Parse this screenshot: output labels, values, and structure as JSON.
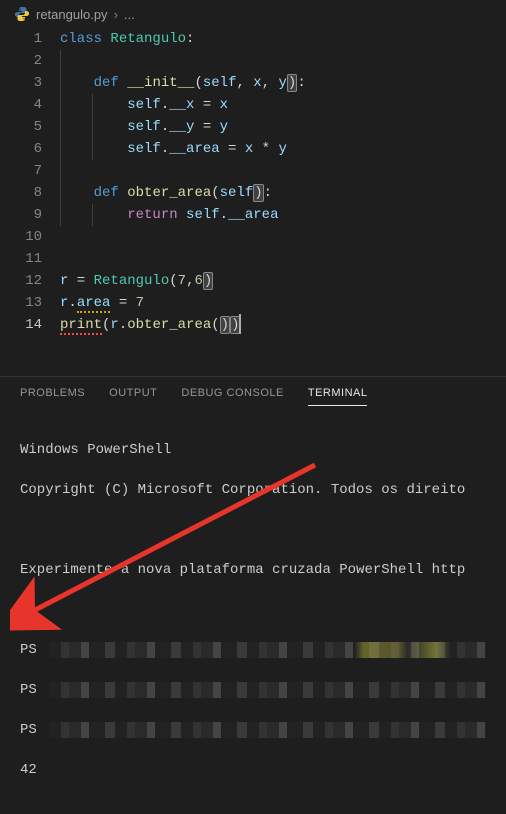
{
  "breadcrumb": {
    "filename": "retangulo.py",
    "overflow": "..."
  },
  "editor": {
    "lines": {
      "l1": {
        "kw": "class",
        "name": "Retangulo",
        "colon": ":"
      },
      "l3": {
        "kw": "def",
        "name": "__init__",
        "params_open": "(",
        "self": "self",
        "c1": ", ",
        "p1": "x",
        "c2": ", ",
        "p2": "y",
        "params_close": ")",
        "colon": ":"
      },
      "l4": {
        "self": "self",
        "dot": ".",
        "attr": "__x",
        "eq": " = ",
        "rhs": "x"
      },
      "l5": {
        "self": "self",
        "dot": ".",
        "attr": "__y",
        "eq": " = ",
        "rhs": "y"
      },
      "l6": {
        "self": "self",
        "dot": ".",
        "attr": "__area",
        "eq": " = ",
        "a": "x",
        "op": " * ",
        "b": "y"
      },
      "l8": {
        "kw": "def",
        "name": "obter_area",
        "params_open": "(",
        "self": "self",
        "params_close": ")",
        "colon": ":"
      },
      "l9": {
        "kw": "return",
        "sp": " ",
        "self": "self",
        "dot": ".",
        "attr": "__area"
      },
      "l12": {
        "var": "r",
        "eq": " = ",
        "cls": "Retangulo",
        "open": "(",
        "a": "7",
        "c": ",",
        "b": "6",
        "close": ")"
      },
      "l13": {
        "var": "r",
        "dot": ".",
        "attr": "area",
        "eq": " = ",
        "val": "7"
      },
      "l14": {
        "fn": "print",
        "open": "(",
        "var": "r",
        "dot": ".",
        "method": "obter_area",
        "open2": "(",
        "close2": ")",
        "close": ")"
      }
    },
    "line_numbers": [
      "1",
      "2",
      "3",
      "4",
      "5",
      "6",
      "7",
      "8",
      "9",
      "10",
      "11",
      "12",
      "13",
      "14"
    ]
  },
  "panel": {
    "tabs": {
      "problems": "PROBLEMS",
      "output": "OUTPUT",
      "debug": "DEBUG CONSOLE",
      "terminal": "TERMINAL"
    }
  },
  "terminal": {
    "banner1": "Windows PowerShell",
    "banner2": "Copyright (C) Microsoft Corporation. Todos os direito",
    "banner3": "Experimente a nova plataforma cruzada PowerShell http",
    "prompt": "PS ",
    "output": "42"
  }
}
